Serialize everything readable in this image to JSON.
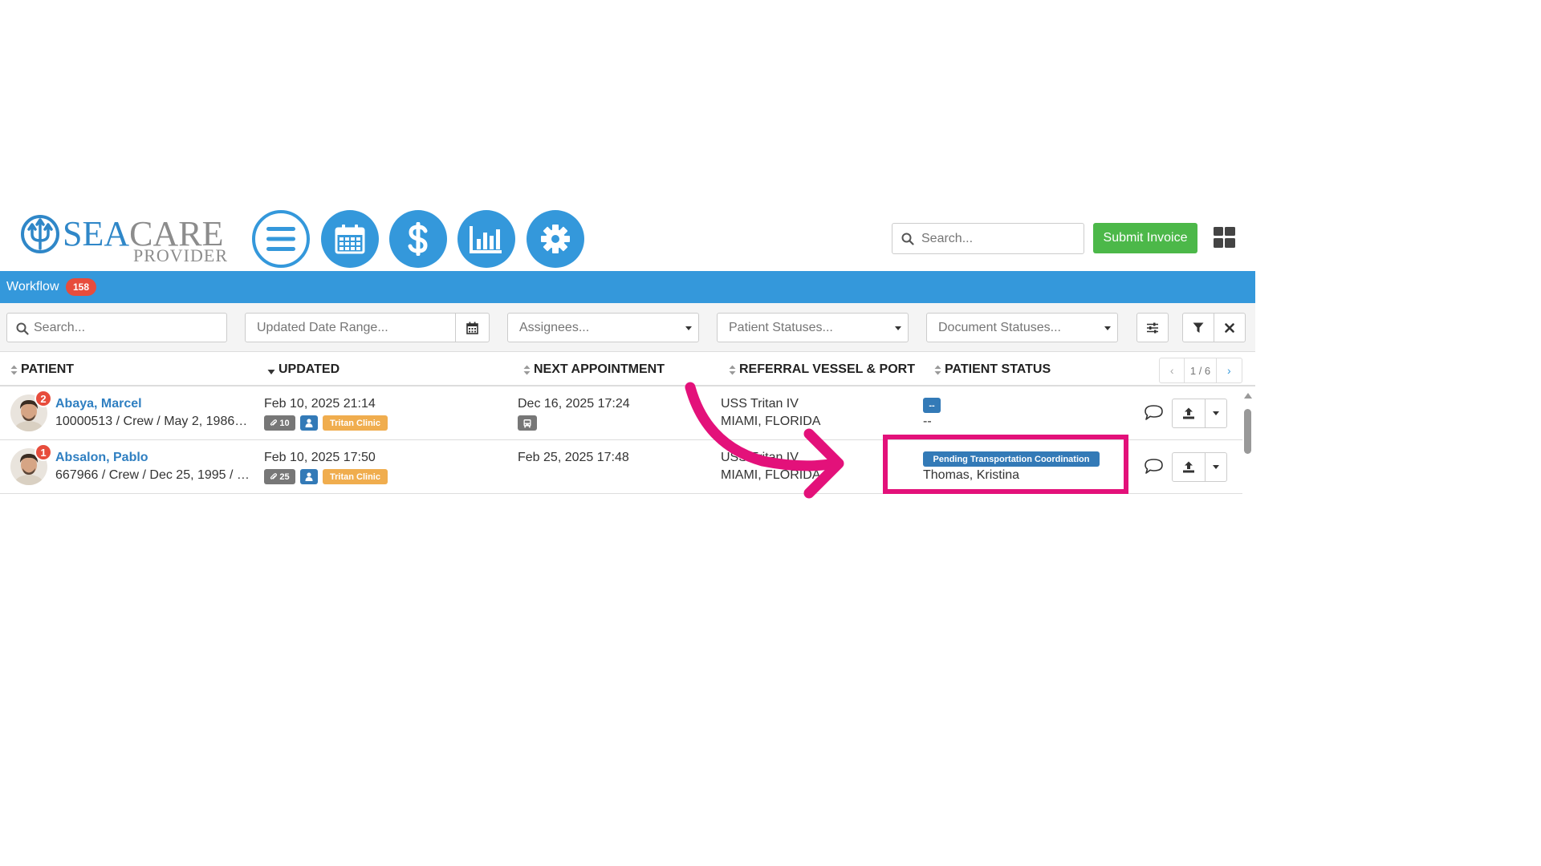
{
  "brand": {
    "name_part1": "SEA",
    "name_part2": "CARE",
    "subtitle": "PROVIDER",
    "primary_color": "#3498db",
    "logo_blue": "#2f87c8"
  },
  "nav_icons": [
    "menu-icon",
    "calendar-icon",
    "dollar-icon",
    "bar-chart-icon",
    "gear-icon"
  ],
  "header": {
    "search_placeholder": "Search...",
    "submit_label": "Submit Invoice",
    "grid_icon": "grid-icon"
  },
  "workflow": {
    "label": "Workflow",
    "count": "158"
  },
  "filters": {
    "search_placeholder": "Search...",
    "date_range_placeholder": "Updated Date Range...",
    "assignees_placeholder": "Assignees...",
    "patient_statuses_placeholder": "Patient Statuses...",
    "document_statuses_placeholder": "Document Statuses..."
  },
  "table": {
    "columns": [
      "PATIENT",
      "UPDATED",
      "NEXT APPOINTMENT",
      "REFERRAL VESSEL & PORT",
      "PATIENT STATUS"
    ],
    "pager": {
      "prev": "‹",
      "page": "1 / 6",
      "next": "›"
    },
    "rows": [
      {
        "notifications": "2",
        "name": "Abaya, Marcel",
        "info": "10000513 / Crew / May 2, 1986 / …",
        "updated": "Feb 10, 2025 21:14",
        "attachments": "10",
        "clinic": "Tritan Clinic",
        "next_appointment": "Dec 16, 2025 17:24",
        "vessel": "USS Tritan IV",
        "port": "MIAMI, FLORIDA",
        "status": "--",
        "assignee": "--"
      },
      {
        "notifications": "1",
        "name": "Absalon, Pablo",
        "info": "667966 / Crew / Dec 25, 1995 / …",
        "updated": "Feb 10, 2025 17:50",
        "attachments": "25",
        "clinic": "Tritan Clinic",
        "next_appointment": "Feb 25, 2025 17:48",
        "vessel": "USS Tritan IV",
        "port": "MIAMI, FLORIDA",
        "status": "Pending Transportation Coordination",
        "assignee": "Thomas, Kristina"
      }
    ]
  },
  "annotation": {
    "color": "#e3117a"
  }
}
